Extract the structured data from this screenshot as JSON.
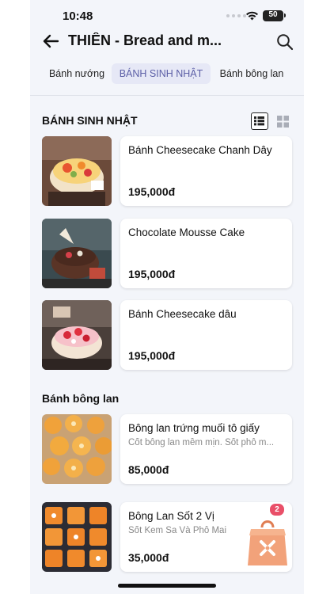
{
  "status_bar": {
    "time": "10:48",
    "battery": "50"
  },
  "header": {
    "title": "THIÊN - Bread and m..."
  },
  "tabs": [
    {
      "label": "Bánh nướng"
    },
    {
      "label": "BÁNH SINH NHẬT",
      "active": true
    },
    {
      "label": "Bánh bông lan"
    }
  ],
  "sections": [
    {
      "title": "BÁNH SINH NHẬT",
      "items": [
        {
          "name": "Bánh Cheesecake Chanh Dây",
          "description": "",
          "price": "195,000đ"
        },
        {
          "name": "Chocolate Mousse Cake",
          "description": "",
          "price": "195,000đ"
        },
        {
          "name": "Bánh Cheesecake dâu",
          "description": "",
          "price": "195,000đ"
        }
      ]
    },
    {
      "title": "Bánh bông lan",
      "items": [
        {
          "name": "Bông lan trứng muối tô giấy",
          "description": "Cốt bông lan mềm mịn. Sốt phô m...",
          "price": "85,000đ"
        },
        {
          "name": "Bông Lan Sốt 2 Vị",
          "description": "Sốt Kem Sa Và Phô Mai",
          "price": "35,000đ"
        }
      ]
    }
  ],
  "cart": {
    "count": "2",
    "icon": "shopping-bag-icon"
  },
  "colors": {
    "background": "#f3f5fa",
    "active_tab_bg": "#e6e8f6",
    "active_tab_text": "#5b5ea6",
    "badge": "#e94f68",
    "bag": "#f2a27a"
  }
}
